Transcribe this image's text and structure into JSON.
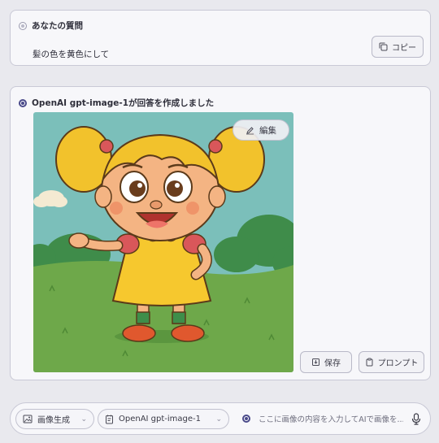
{
  "question": {
    "title": "あなたの質問",
    "text": "髪の色を黄色にして",
    "copy_label": "コピー"
  },
  "answer": {
    "title": "OpenAI gpt-image-1が回答を作成しました",
    "edit_label": "編集",
    "save_label": "保存",
    "prompt_label": "プロンプト",
    "image_alt": "cartoon girl with yellow pigtails in a yellow dress"
  },
  "input_bar": {
    "mode_label": "画像生成",
    "model_label": "OpenAI gpt-image-1",
    "placeholder": "ここに画像の内容を入力してAIで画像を..."
  },
  "colors": {
    "accent": "#4a4a8a",
    "background": "#e9e9ee",
    "card": "#f7f7fa",
    "border": "#c9c9d6"
  },
  "icons": {
    "question_marker": "radio-outline-icon",
    "answer_marker": "radio-filled-icon",
    "copy": "copy-icon",
    "edit": "pencil-icon",
    "save": "save-icon",
    "prompt": "clipboard-icon",
    "mode": "image-icon",
    "model": "document-icon",
    "mic": "microphone-icon"
  }
}
